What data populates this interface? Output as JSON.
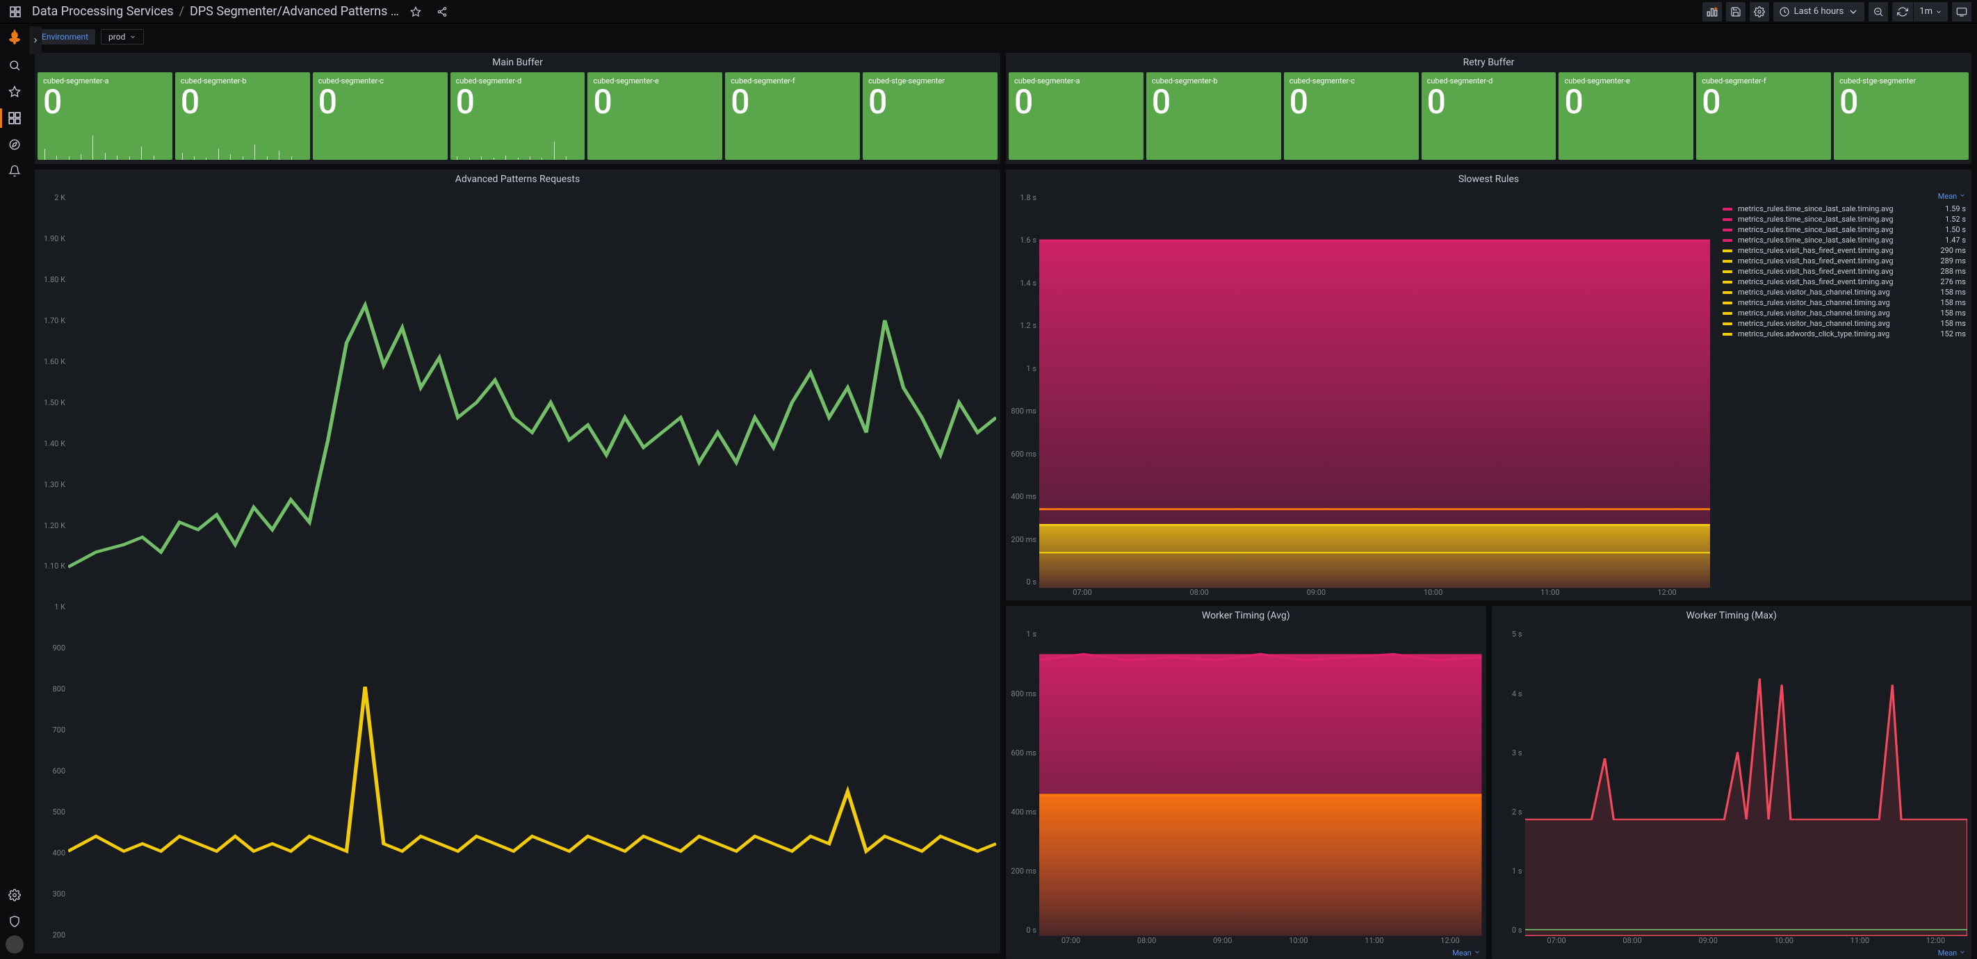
{
  "breadcrumb": {
    "folder": "Data Processing Services",
    "dashboard": "DPS Segmenter/Advanced Patterns …"
  },
  "toolbar": {
    "timerange": "Last 6 hours",
    "refresh_interval": "1m"
  },
  "variable": {
    "label": "Environment",
    "value": "prod"
  },
  "panels": {
    "main_buffer": {
      "title": "Main Buffer",
      "stats": [
        {
          "label": "cubed-segmenter-a",
          "value": "0",
          "sparks": [
            10,
            4,
            3,
            5,
            22,
            6,
            4,
            3,
            12,
            4
          ]
        },
        {
          "label": "cubed-segmenter-b",
          "value": "0",
          "sparks": [
            6,
            3,
            2,
            10,
            5,
            3,
            14,
            3,
            8,
            3
          ]
        },
        {
          "label": "cubed-segmenter-c",
          "value": "0",
          "sparks": []
        },
        {
          "label": "cubed-segmenter-d",
          "value": "0",
          "sparks": [
            3,
            2,
            3,
            2,
            4,
            2,
            3,
            2,
            16,
            3
          ]
        },
        {
          "label": "cubed-segmenter-e",
          "value": "0",
          "sparks": []
        },
        {
          "label": "cubed-segmenter-f",
          "value": "0",
          "sparks": []
        },
        {
          "label": "cubed-stge-segmenter",
          "value": "0",
          "sparks": []
        }
      ]
    },
    "retry_buffer": {
      "title": "Retry Buffer",
      "stats": [
        {
          "label": "cubed-segmenter-a",
          "value": "0"
        },
        {
          "label": "cubed-segmenter-b",
          "value": "0"
        },
        {
          "label": "cubed-segmenter-c",
          "value": "0"
        },
        {
          "label": "cubed-segmenter-d",
          "value": "0"
        },
        {
          "label": "cubed-segmenter-e",
          "value": "0"
        },
        {
          "label": "cubed-segmenter-f",
          "value": "0"
        },
        {
          "label": "cubed-stge-segmenter",
          "value": "0"
        }
      ]
    },
    "advanced": {
      "title": "Advanced Patterns Requests",
      "y_ticks": [
        "2 K",
        "1.90 K",
        "1.80 K",
        "1.70 K",
        "1.60 K",
        "1.50 K",
        "1.40 K",
        "1.30 K",
        "1.20 K",
        "1.10 K",
        "1 K",
        "900",
        "800",
        "700",
        "600",
        "500",
        "400",
        "300",
        "200"
      ]
    },
    "slowest": {
      "title": "Slowest Rules",
      "y_ticks": [
        "1.8 s",
        "1.6 s",
        "1.4 s",
        "1.2 s",
        "1 s",
        "800 ms",
        "600 ms",
        "400 ms",
        "200 ms",
        "0 s"
      ],
      "x_ticks": [
        "07:00",
        "08:00",
        "09:00",
        "10:00",
        "11:00",
        "12:00"
      ],
      "legend_header": "Mean",
      "legend": [
        {
          "c": "#e0226e",
          "n": "metrics_rules.time_since_last_sale.timing.avg",
          "v": "1.59 s"
        },
        {
          "c": "#e0226e",
          "n": "metrics_rules.time_since_last_sale.timing.avg",
          "v": "1.52 s"
        },
        {
          "c": "#e0226e",
          "n": "metrics_rules.time_since_last_sale.timing.avg",
          "v": "1.50 s"
        },
        {
          "c": "#e0226e",
          "n": "metrics_rules.time_since_last_sale.timing.avg",
          "v": "1.47 s"
        },
        {
          "c": "#f2cc0c",
          "n": "metrics_rules.visit_has_fired_event.timing.avg",
          "v": "290 ms"
        },
        {
          "c": "#f2cc0c",
          "n": "metrics_rules.visit_has_fired_event.timing.avg",
          "v": "289 ms"
        },
        {
          "c": "#f2cc0c",
          "n": "metrics_rules.visit_has_fired_event.timing.avg",
          "v": "288 ms"
        },
        {
          "c": "#f2cc0c",
          "n": "metrics_rules.visit_has_fired_event.timing.avg",
          "v": "276 ms"
        },
        {
          "c": "#f2cc0c",
          "n": "metrics_rules.visitor_has_channel.timing.avg",
          "v": "158 ms"
        },
        {
          "c": "#f2cc0c",
          "n": "metrics_rules.visitor_has_channel.timing.avg",
          "v": "158 ms"
        },
        {
          "c": "#f2cc0c",
          "n": "metrics_rules.visitor_has_channel.timing.avg",
          "v": "158 ms"
        },
        {
          "c": "#f2cc0c",
          "n": "metrics_rules.visitor_has_channel.timing.avg",
          "v": "158 ms"
        },
        {
          "c": "#f2cc0c",
          "n": "metrics_rules.adwords_click_type.timing.avg",
          "v": "152 ms"
        }
      ]
    },
    "worker_avg": {
      "title": "Worker Timing (Avg)",
      "y_ticks": [
        "1 s",
        "800 ms",
        "600 ms",
        "400 ms",
        "200 ms",
        "0 s"
      ],
      "x_ticks": [
        "07:00",
        "08:00",
        "09:00",
        "10:00",
        "11:00",
        "12:00"
      ],
      "footer": "Mean"
    },
    "worker_max": {
      "title": "Worker Timing (Max)",
      "y_ticks": [
        "5 s",
        "4 s",
        "3 s",
        "2 s",
        "1 s",
        "0 s"
      ],
      "x_ticks": [
        "07:00",
        "08:00",
        "09:00",
        "10:00",
        "11:00",
        "12:00"
      ],
      "footer": "Mean"
    }
  },
  "chart_data": [
    {
      "type": "line",
      "title": "Advanced Patterns Requests",
      "xlabel": "",
      "ylabel": "",
      "ylim": [
        200,
        2000
      ],
      "x_range": [
        "06:45",
        "12:45"
      ],
      "series": [
        {
          "name": "green",
          "color": "#73bf69",
          "approx_values": [
            1100,
            1150,
            1180,
            1200,
            1250,
            1220,
            1260,
            1500,
            1650,
            1720,
            1600,
            1550,
            1500,
            1480,
            1500,
            1460,
            1400,
            1450,
            1430,
            1400,
            1480,
            1700,
            1600,
            1500
          ]
        },
        {
          "name": "yellow",
          "color": "#f2cc0c",
          "approx_values": [
            420,
            440,
            430,
            440,
            820,
            430,
            440,
            450,
            430,
            450,
            460,
            440,
            430,
            440,
            440,
            430,
            460,
            640,
            440,
            430,
            420,
            450,
            440,
            430
          ]
        }
      ]
    },
    {
      "type": "area",
      "title": "Slowest Rules",
      "ylim": [
        0,
        1.8
      ],
      "y_unit": "s",
      "x_ticks": [
        "07:00",
        "08:00",
        "09:00",
        "10:00",
        "11:00",
        "12:00"
      ],
      "series": [
        {
          "name": "time_since_last_sale",
          "color": "#e0226e",
          "mean_s": 1.52,
          "band": [
            1.47,
            1.59
          ]
        },
        {
          "name": "visit_has_fired_event",
          "color": "#f2cc0c",
          "mean_s": 0.286,
          "band": [
            0.276,
            0.29
          ]
        },
        {
          "name": "visitor_has_channel",
          "color": "#f2cc0c",
          "mean_s": 0.158
        },
        {
          "name": "adwords_click_type",
          "color": "#f2cc0c",
          "mean_s": 0.152
        }
      ]
    },
    {
      "type": "area",
      "title": "Worker Timing (Avg)",
      "ylim": [
        0,
        1
      ],
      "y_unit": "s",
      "series": [
        {
          "name": "series-red",
          "color": "#e0226e",
          "approx_level": 0.92
        },
        {
          "name": "series-orange",
          "color": "#ff780a",
          "approx_level": 0.46
        }
      ]
    },
    {
      "type": "line",
      "title": "Worker Timing (Max)",
      "ylim": [
        0,
        5
      ],
      "y_unit": "s",
      "series": [
        {
          "name": "series-red",
          "color": "#f2495c",
          "approx_baseline": 1.9,
          "spikes_to": 4.2
        },
        {
          "name": "series-green",
          "color": "#73bf69",
          "approx_baseline": 0.1
        }
      ]
    }
  ]
}
